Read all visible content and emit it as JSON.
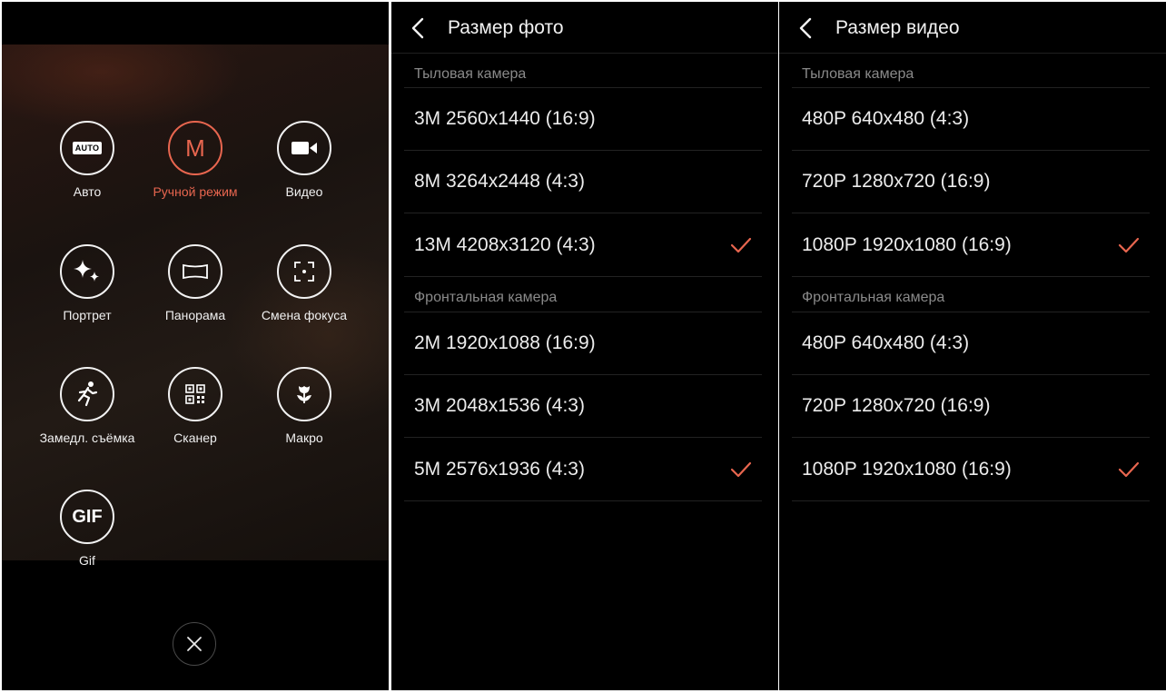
{
  "modes": {
    "items": [
      {
        "label": "Авто",
        "icon": "auto-icon"
      },
      {
        "label": "Ручной режим",
        "icon": "manual-m-icon",
        "active": true
      },
      {
        "label": "Видео",
        "icon": "video-camera-icon"
      },
      {
        "label": "Портрет",
        "icon": "sparkle-icon"
      },
      {
        "label": "Панорама",
        "icon": "panorama-icon"
      },
      {
        "label": "Смена фокуса",
        "icon": "focus-frame-icon"
      },
      {
        "label": "Замедл. съёмка",
        "icon": "running-man-icon"
      },
      {
        "label": "Сканер",
        "icon": "qr-code-icon"
      },
      {
        "label": "Макро",
        "icon": "flower-icon"
      },
      {
        "label": "Gif",
        "icon": "gif-icon"
      }
    ],
    "auto_badge": "AUTO",
    "manual_glyph": "M",
    "gif_glyph": "GIF",
    "active_color": "#e8664f"
  },
  "photo_size": {
    "title": "Размер фото",
    "rear_label": "Тыловая камера",
    "rear": [
      {
        "text": "3M 2560x1440 (16:9)",
        "selected": false
      },
      {
        "text": "8M 3264x2448 (4:3)",
        "selected": false
      },
      {
        "text": "13M 4208x3120 (4:3)",
        "selected": true
      }
    ],
    "front_label": "Фронтальная камера",
    "front": [
      {
        "text": "2M 1920x1088 (16:9)",
        "selected": false
      },
      {
        "text": "3M 2048x1536 (4:3)",
        "selected": false
      },
      {
        "text": "5M 2576x1936 (4:3)",
        "selected": true
      }
    ]
  },
  "video_size": {
    "title": "Размер видео",
    "rear_label": "Тыловая камера",
    "rear": [
      {
        "text": "480P 640x480 (4:3)",
        "selected": false
      },
      {
        "text": "720P 1280x720 (16:9)",
        "selected": false
      },
      {
        "text": "1080P 1920x1080 (16:9)",
        "selected": true
      }
    ],
    "front_label": "Фронтальная камера",
    "front": [
      {
        "text": "480P 640x480 (4:3)",
        "selected": false
      },
      {
        "text": "720P 1280x720 (16:9)",
        "selected": false
      },
      {
        "text": "1080P 1920x1080 (16:9)",
        "selected": true
      }
    ]
  }
}
